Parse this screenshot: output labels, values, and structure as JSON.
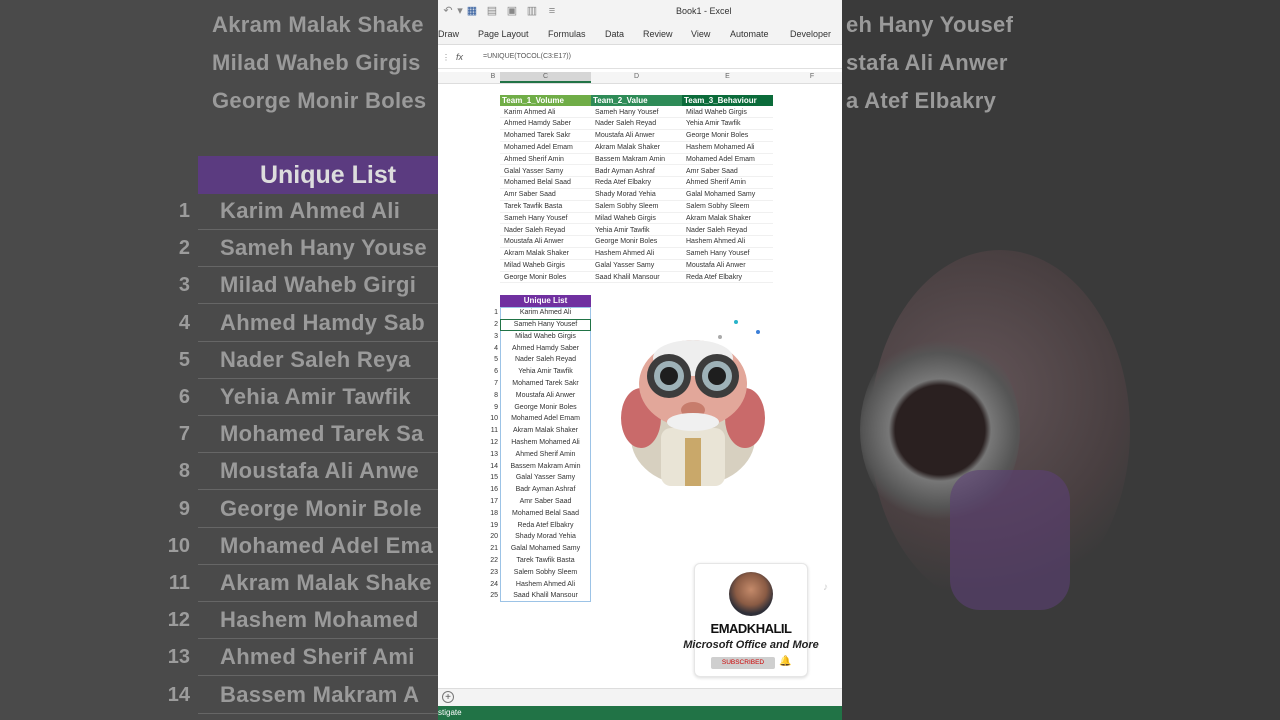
{
  "window": {
    "title": "Book1 - Excel"
  },
  "ribbon": {
    "tabs": [
      "Draw",
      "Page Layout",
      "Formulas",
      "Data",
      "Review",
      "View",
      "Automate",
      "Developer"
    ]
  },
  "formula_bar": {
    "fx": "fx",
    "formula": "=UNIQUE(TOCOL(C3:E17))"
  },
  "columns": [
    "B",
    "C",
    "D",
    "E",
    "F"
  ],
  "table": {
    "headers": [
      "Team_1_Volume",
      "Team_2_Value",
      "Team_3_Behaviour"
    ],
    "header_colors": [
      "#70ad47",
      "#2e8b57",
      "#0b6b3a"
    ],
    "rows": [
      [
        "Karim Ahmed Ali",
        "Sameh Hany Yousef",
        "Milad Waheb Girgis"
      ],
      [
        "Ahmed Hamdy Saber",
        "Nader Saleh Reyad",
        "Yehia Amir Tawfik"
      ],
      [
        "Mohamed Tarek Sakr",
        "Moustafa Ali Anwer",
        "George Monir Boles"
      ],
      [
        "Mohamed Adel Emam",
        "Akram Malak Shaker",
        "Hashem Mohamed Ali"
      ],
      [
        "Ahmed Sherif Amin",
        "Bassem Makram Amin",
        "Mohamed Adel Emam"
      ],
      [
        "Galal Yasser Samy",
        "Badr Ayman Ashraf",
        "Amr Saber Saad"
      ],
      [
        "Mohamed Belal Saad",
        "Reda Atef Elbakry",
        "Ahmed Sherif Amin"
      ],
      [
        "Amr Saber Saad",
        "Shady Morad Yehia",
        "Galal Mohamed Samy"
      ],
      [
        "Tarek Tawfik Basta",
        "Salem Sobhy Sleem",
        "Salem Sobhy Sleem"
      ],
      [
        "Sameh Hany Yousef",
        "Milad Waheb Girgis",
        "Akram Malak Shaker"
      ],
      [
        "Nader Saleh Reyad",
        "Yehia Amir Tawfik",
        "Nader Saleh Reyad"
      ],
      [
        "Moustafa Ali Anwer",
        "George Monir Boles",
        "Hashem Ahmed Ali"
      ],
      [
        "Akram Malak Shaker",
        "Hashem Ahmed Ali",
        "Sameh Hany Yousef"
      ],
      [
        "Milad Waheb Girgis",
        "Galal Yasser Samy",
        "Moustafa Ali Anwer"
      ],
      [
        "George Monir Boles",
        "Saad Khalil Mansour",
        "Reda Atef Elbakry"
      ]
    ]
  },
  "unique_list": {
    "header": "Unique List",
    "items": [
      "Karim Ahmed Ali",
      "Sameh Hany Yousef",
      "Milad Waheb Girgis",
      "Ahmed Hamdy Saber",
      "Nader Saleh Reyad",
      "Yehia Amir Tawfik",
      "Mohamed Tarek Sakr",
      "Moustafa Ali Anwer",
      "George Monir Boles",
      "Mohamed Adel Emam",
      "Akram Malak Shaker",
      "Hashem Mohamed Ali",
      "Ahmed Sherif Amin",
      "Bassem Makram Amin",
      "Galal Yasser Samy",
      "Badr Ayman Ashraf",
      "Amr Saber Saad",
      "Mohamed Belal Saad",
      "Reda Atef Elbakry",
      "Shady Morad Yehia",
      "Galal Mohamed Samy",
      "Tarek Tawfik Basta",
      "Salem Sobhy Sleem",
      "Hashem Ahmed Ali",
      "Saad Khalil Mansour"
    ]
  },
  "background": {
    "top_left": [
      "Akram Malak Shake",
      "Milad Waheb Girgis",
      "George Monir Boles"
    ],
    "top_right": [
      "eh Hany Yousef",
      "stafa Ali Anwer",
      "a Atef Elbakry"
    ],
    "header": "Unique List",
    "list": [
      "Karim Ahmed Ali",
      "Sameh Hany Youse",
      "Milad Waheb Girgi",
      "Ahmed Hamdy Sab",
      "Nader Saleh Reya",
      "Yehia Amir Tawfik",
      "Mohamed Tarek Sa",
      "Moustafa Ali Anwe",
      "George Monir Bole",
      "Mohamed Adel Ema",
      "Akram Malak Shake",
      "Hashem Mohamed",
      "Ahmed Sherif Ami",
      "Bassem Makram A"
    ]
  },
  "creator": {
    "name": "EMADKHALIL",
    "tagline": "Microsoft Office and More",
    "subscribed": "SUBSCRIBED"
  },
  "status": {
    "text": "stigate"
  },
  "colors": {
    "accent": "#217346",
    "list_header": "#7030a0"
  }
}
